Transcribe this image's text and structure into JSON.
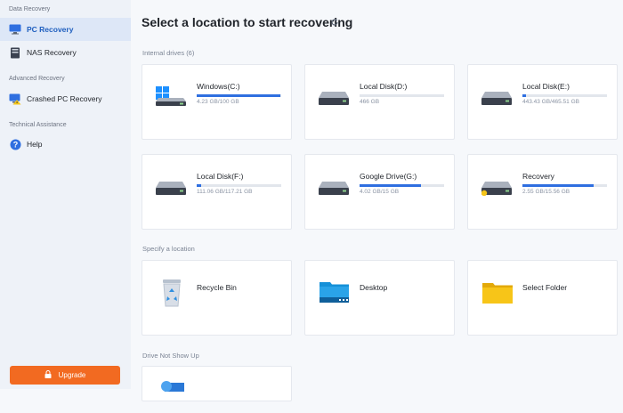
{
  "sidebar": {
    "sections": [
      {
        "title": "Data Recovery"
      },
      {
        "title": "Advanced Recovery"
      },
      {
        "title": "Technical Assistance"
      }
    ],
    "items": [
      {
        "label": "PC Recovery",
        "icon": "monitor-icon"
      },
      {
        "label": "NAS Recovery",
        "icon": "nas-icon"
      },
      {
        "label": "Crashed PC Recovery",
        "icon": "crashed-pc-icon"
      },
      {
        "label": "Help",
        "icon": "help-icon"
      }
    ],
    "upgrade_label": "Upgrade"
  },
  "main": {
    "title": "Select a location to start recovering",
    "internal_label": "Internal drives (6)",
    "specify_label": "Specify a location",
    "drive_not_show_label": "Drive Not Show Up",
    "drives": [
      {
        "name": "Windows(C:)",
        "size": "4.23 GB/100 GB",
        "used": 0.99
      },
      {
        "name": "Local Disk(D:)",
        "size": "466 GB",
        "used": 0
      },
      {
        "name": "Local Disk(E:)",
        "size": "443.43 GB/465.51 GB",
        "used": 0.04
      },
      {
        "name": "Local Disk(F:)",
        "size": "111.06 GB/117.21 GB",
        "used": 0.05
      },
      {
        "name": "Google Drive(G:)",
        "size": "4.02 GB/15 GB",
        "used": 0.73
      },
      {
        "name": "Recovery",
        "size": "2.55 GB/15.56 GB",
        "used": 0.84
      }
    ],
    "locations": [
      {
        "name": "Recycle Bin",
        "icon": "recycle-bin-icon"
      },
      {
        "name": "Desktop",
        "icon": "desktop-folder-icon"
      },
      {
        "name": "Select Folder",
        "icon": "folder-icon"
      }
    ],
    "colors": {
      "accent": "#2f6fe0",
      "upgrade": "#f26a21"
    }
  }
}
